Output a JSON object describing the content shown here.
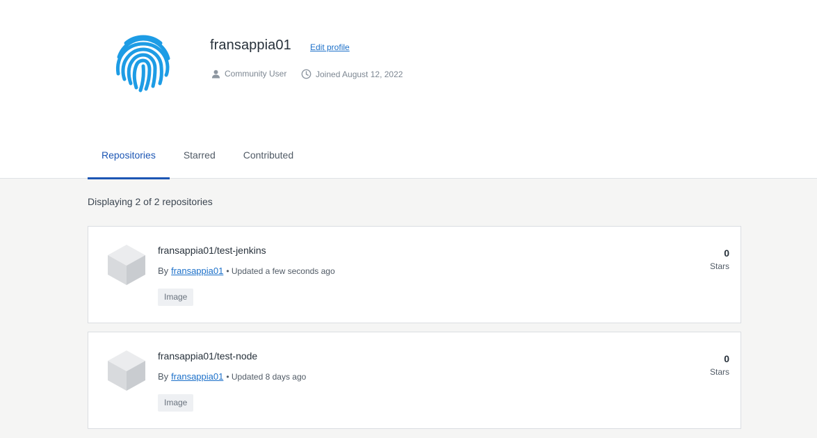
{
  "profile": {
    "username": "fransappia01",
    "edit_label": "Edit profile",
    "role": "Community User",
    "joined": "Joined August 12, 2022",
    "avatar_icon": "fingerprint-icon",
    "accent_color": "#1d9ce5"
  },
  "tabs": [
    {
      "label": "Repositories",
      "active": true
    },
    {
      "label": "Starred",
      "active": false
    },
    {
      "label": "Contributed",
      "active": false
    }
  ],
  "listing": {
    "summary": "Displaying 2 of 2 repositories"
  },
  "repositories": [
    {
      "name": "fransappia01/test-jenkins",
      "by_label": "By",
      "author": "fransappia01",
      "updated": "• Updated a few seconds ago",
      "badge": "Image",
      "stars": "0",
      "stars_label": "Stars"
    },
    {
      "name": "fransappia01/test-node",
      "by_label": "By",
      "author": "fransappia01",
      "updated": "• Updated 8 days ago",
      "badge": "Image",
      "stars": "0",
      "stars_label": "Stars"
    }
  ]
}
